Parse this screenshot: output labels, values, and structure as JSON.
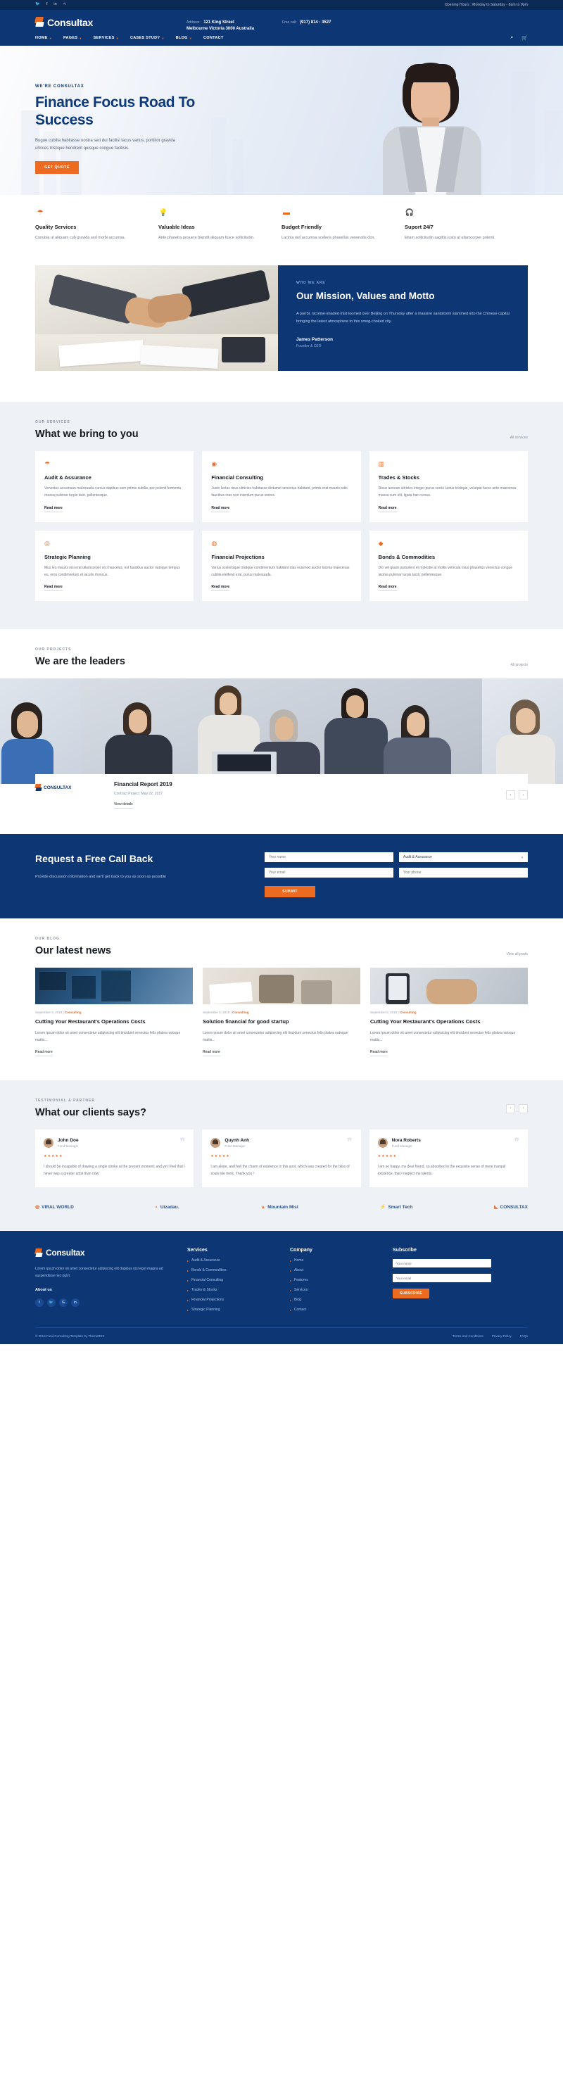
{
  "topbar": {
    "social": [
      "twitter-icon",
      "facebook-icon",
      "linkedin-icon",
      "rss-icon"
    ],
    "social_glyphs": [
      "🐦",
      "f",
      "in",
      "∿"
    ],
    "opening": "Opening Hours : Monday to Saturday - 8am to 9pm"
  },
  "header": {
    "brand": "Consultax",
    "address_label": "Address:",
    "address_value": "121 King Street",
    "address_line2": "Melbourne Victoria 3000 Australia",
    "phone_label": "Free call:",
    "phone_value": "(917) 814 - 3527"
  },
  "nav": {
    "items": [
      {
        "label": "HOME",
        "caret": true
      },
      {
        "label": "PAGES",
        "caret": true
      },
      {
        "label": "SERVICES",
        "caret": true
      },
      {
        "label": "CASES STUDY",
        "caret": true
      },
      {
        "label": "BLOG",
        "caret": true
      },
      {
        "label": "CONTACT",
        "caret": false
      }
    ],
    "search_icon": "search-icon",
    "cart_icon": "cart-icon"
  },
  "hero": {
    "eyebrow": "WE'RE CONSULTAX",
    "title": "Finance Focus Road To Success",
    "desc": "Bugue cubilia habitasse nostra sed dui facilisi lacus varius, porttitor gravida ultrices tristique hendrerit quisque congue facilisis.",
    "cta": "GET QUOTE"
  },
  "features": [
    {
      "icon": "umbrella-icon",
      "title": "Quality Services",
      "desc": "Conubia ut aliquam cub gravida sed morbi accumsa."
    },
    {
      "icon": "lightbulb-icon",
      "title": "Valuable Ideas",
      "desc": "Ante pharetra posuere blandit aliquam fusce sollicitudin."
    },
    {
      "icon": "wallet-icon",
      "title": "Budget Friendly",
      "desc": "Lacinia nisl accumsa sceleris phasellus venenatis don."
    },
    {
      "icon": "headset-icon",
      "title": "Suport 24/7",
      "desc": "Etiam sollicitudin sagittis justo at ullamcorper potenti."
    }
  ],
  "mission": {
    "eyebrow": "WHO WE ARE",
    "title": "Our Mission, Values and Motto",
    "desc": "A purrbl, nicotine-shaded mist loomed over Beijing on Thursday after a massive sandstorm slammed into the Chinese capital bringing the latest atmosphere to this smog-choked city.",
    "name": "James Patterson",
    "role": "Founder & CEO"
  },
  "services": {
    "eyebrow": "OUR SERVICES",
    "title": "What we bring to you",
    "link": "All services",
    "cards": [
      {
        "icon": "umbrella-icon",
        "title": "Audit & Assurance",
        "desc": "Venectus accumsan malesuada cursus dapibus sem primis cubilia, per potenti fermentu massa pulvinar turpis tacit, pellentesque.",
        "more": "Read more"
      },
      {
        "icon": "chart-icon",
        "title": "Financial Consulting",
        "desc": "Justo luctus risus ultricies habitasse dictumst senectus habitant, primis erat mauris odio faucibus cras non interdum purus socios.",
        "more": "Read more"
      },
      {
        "icon": "bars-icon",
        "title": "Trades & Stocks",
        "desc": "Risus aenean ultricies integer purus sociis luctus tristique, volutpat fusce ante maecenas massa cum elit, ligula hac cursus.",
        "more": "Read more"
      },
      {
        "icon": "target-icon",
        "title": "Strategic Planning",
        "desc": "Mus leo mauris nisi erat ullamcorper orci hascelus, est faucibus auctor natoque tempus eu, eros condimentum et iaculis rhoncus.",
        "more": "Read more"
      },
      {
        "icon": "coins-icon",
        "title": "Financial Projections",
        "desc": "Varius scelerisque tristique condimentum habitant dias euismod auctor lacinia maecenas cubilia eleifend erat, purus malesuada.",
        "more": "Read more"
      },
      {
        "icon": "gem-icon",
        "title": "Bonds & Commodities",
        "desc": "Dio vel quam parturient et molestie at mollis vehicula risus phasellus venectus congue lacinia pulvinar turpis taciti, pellentesque.",
        "more": "Read more"
      }
    ]
  },
  "leaders": {
    "eyebrow": "OUR PROJECTS",
    "title": "We are the leaders",
    "link": "All projects",
    "project_logo_text": "CONSULTAX",
    "project_title": "Financial Report 2019",
    "project_meta": "Contract Project: May 22, 2017",
    "project_more": "View details",
    "prev_icon": "chevron-left-icon",
    "next_icon": "chevron-right-icon"
  },
  "callback": {
    "title": "Request a Free Call Back",
    "sub": "Provide discussion information and we'll get back to you as soon as possible",
    "fields": [
      {
        "name": "name-input",
        "placeholder": "Your name"
      },
      {
        "name": "service-select",
        "value": "Audit & Assurance"
      },
      {
        "name": "email-input",
        "placeholder": "Your email"
      },
      {
        "name": "phone-input",
        "placeholder": "Your phone"
      }
    ],
    "select_caret": "chevron-down-icon",
    "submit": "SUBMIT"
  },
  "blog": {
    "eyebrow": "OUR BLOG",
    "title": "Our latest news",
    "link": "View all posts",
    "posts": [
      {
        "date": "September 5, 2019",
        "category": "Consulting",
        "title": "Cutting Your Restaurant's Operations Costs",
        "desc": "Lorem ipsum dolor sit amet consectetur adipisicing elit tincidunt senectus felis platea natoque mattis...",
        "more": "Read more"
      },
      {
        "date": "September 5, 2019",
        "category": "Consulting",
        "title": "Solution financial for good startup",
        "desc": "Lorem ipsum dolor sit amet consectetur adipisicing elit tincidunt senectus felis platea natoque mattis...",
        "more": "Read more"
      },
      {
        "date": "September 5, 2019",
        "category": "Consulting",
        "title": "Cutting Your Restaurant's Operations Costs",
        "desc": "Lorem ipsum dolor sit amet consectetur adipisicing elit tincidunt senectus felis platea natoque mattis...",
        "more": "Read more"
      }
    ]
  },
  "testimonials": {
    "eyebrow": "TESTIMONIAL & PARTNER",
    "title": "What our clients says?",
    "prev_icon": "chevron-left-icon",
    "next_icon": "chevron-right-icon",
    "cards": [
      {
        "name": "John Doe",
        "role": "Fund Manager",
        "stars": "★★★★★",
        "text": "I should be incapable of drawing a single stroke at the present moment; and yet I feel that I never was a greater artist than now."
      },
      {
        "name": "Quynh Anh",
        "role": "Fund Manager",
        "stars": "★★★★★",
        "text": "I am alone, and feel the charm of existence in this spot, which was created for the bliss of souls like mine. Thank you !"
      },
      {
        "name": "Nora Roberts",
        "role": "Fund Manager",
        "stars": "★★★★★",
        "text": "I am so happy, my dear friend, so absorbed in the exquisite sense of mere tranquil existence, that I neglect my talents."
      }
    ],
    "brands": [
      {
        "icon": "globe-icon",
        "label": "VIRAL WORLD"
      },
      {
        "icon": "u-icon",
        "label": "Uizadau."
      },
      {
        "icon": "mountain-icon",
        "label": "Mountain Mist"
      },
      {
        "icon": "bolt-icon",
        "label": "Smart Tech"
      },
      {
        "icon": "consultax-icon",
        "label": "CONSULTAX"
      }
    ]
  },
  "footer": {
    "brand": "Consultax",
    "desc": "Lorem ipsum dolor sit amet consectetur adipiscing elit dapibus nisl eget magna ad suspendisse nec pulvi.",
    "about_label": "About us",
    "social": [
      "f",
      "🐦",
      "G",
      "in"
    ],
    "services": {
      "heading": "Services",
      "items": [
        "Audit & Assurance",
        "Bonds & Commodities",
        "Financial Consulting",
        "Trades & Stocks",
        "Financial Projections",
        "Strategic Planning"
      ]
    },
    "company": {
      "heading": "Company",
      "items": [
        "Home",
        "About",
        "Features",
        "Services",
        "Blog",
        "Contact"
      ]
    },
    "subscribe": {
      "heading": "Subscribe",
      "name_placeholder": "Your name",
      "email_placeholder": "Your email",
      "button": "SUBSCRIBE"
    },
    "copyright": "© 2019 Fund Consulting Template by ThemeREX",
    "links": [
      "Terms and Conditions",
      "Privacy Policy",
      "FAQs"
    ]
  }
}
